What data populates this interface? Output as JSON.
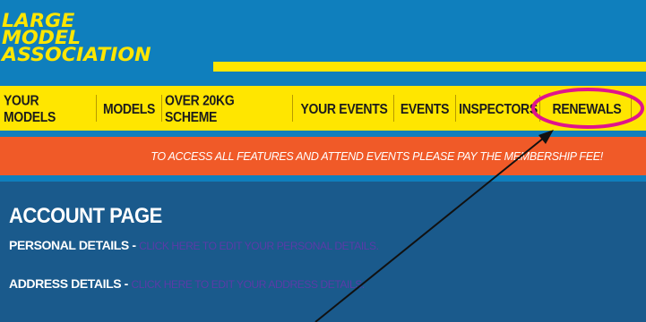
{
  "header": {
    "logo_lines": [
      "LARGE",
      "MODEL",
      "ASSOCIATION"
    ]
  },
  "nav": {
    "items": [
      "YOUR MODELS",
      "MODELS",
      "OVER 20KG SCHEME",
      "YOUR EVENTS",
      "EVENTS",
      "INSPECTORS",
      "RENEWALS"
    ]
  },
  "alert": {
    "text": "TO ACCESS ALL FEATURES AND ATTEND EVENTS PLEASE PAY THE MEMBERSHIP FEE!"
  },
  "account": {
    "title": "ACCOUNT PAGE",
    "personal_label": "PERSONAL DETAILS -",
    "personal_link": "CLICK HERE TO EDIT YOUR PERSONAL DETAILS.",
    "address_label": "ADDRESS DETAILS -",
    "address_link": "CLICK HERE TO EDIT YOUR ADDRESS DETAILS."
  },
  "colors": {
    "header_blue": "#0f7fbd",
    "brand_yellow": "#ffe600",
    "alert_orange": "#f05a28",
    "content_blue": "#1a5a8c",
    "link_purple": "#5b3ba8",
    "highlight_magenta": "#e0148c"
  }
}
